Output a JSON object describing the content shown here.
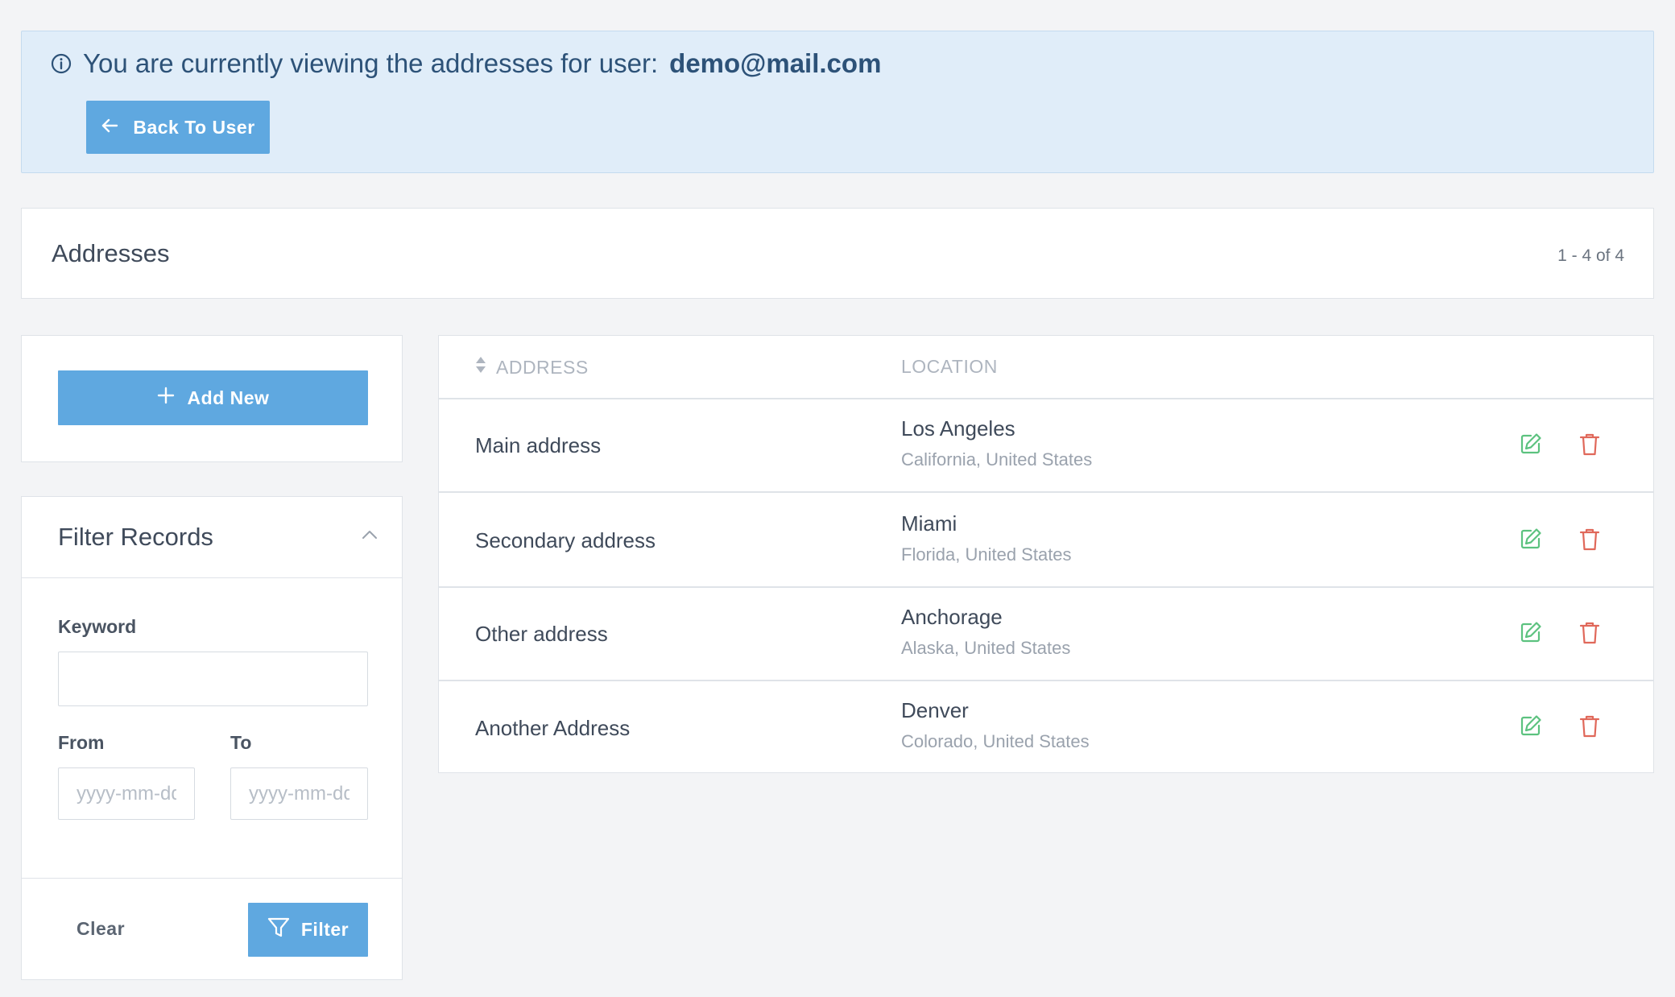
{
  "banner": {
    "message": "You are currently viewing the addresses for user:",
    "email": "demo@mail.com",
    "back_label": "Back To User"
  },
  "header": {
    "title": "Addresses",
    "count": "1 - 4 of 4"
  },
  "actions": {
    "add_label": "Add New"
  },
  "filter": {
    "title": "Filter Records",
    "keyword_label": "Keyword",
    "keyword_value": "",
    "from_label": "From",
    "from_placeholder": "yyyy-mm-dd",
    "to_label": "To",
    "to_placeholder": "yyyy-mm-dd",
    "clear_label": "Clear",
    "filter_label": "Filter"
  },
  "table": {
    "columns": [
      "ADDRESS",
      "LOCATION"
    ],
    "rows": [
      {
        "address": "Main address",
        "city": "Los Angeles",
        "region": "California, United States"
      },
      {
        "address": "Secondary address",
        "city": "Miami",
        "region": "Florida, United States"
      },
      {
        "address": "Other address",
        "city": "Anchorage",
        "region": "Alaska, United States"
      },
      {
        "address": "Another Address",
        "city": "Denver",
        "region": "Colorado, United States"
      }
    ]
  },
  "colors": {
    "primary": "#5fa8e0",
    "banner_bg": "#e0edf9",
    "edit": "#5cc27f",
    "delete": "#e0685a"
  }
}
